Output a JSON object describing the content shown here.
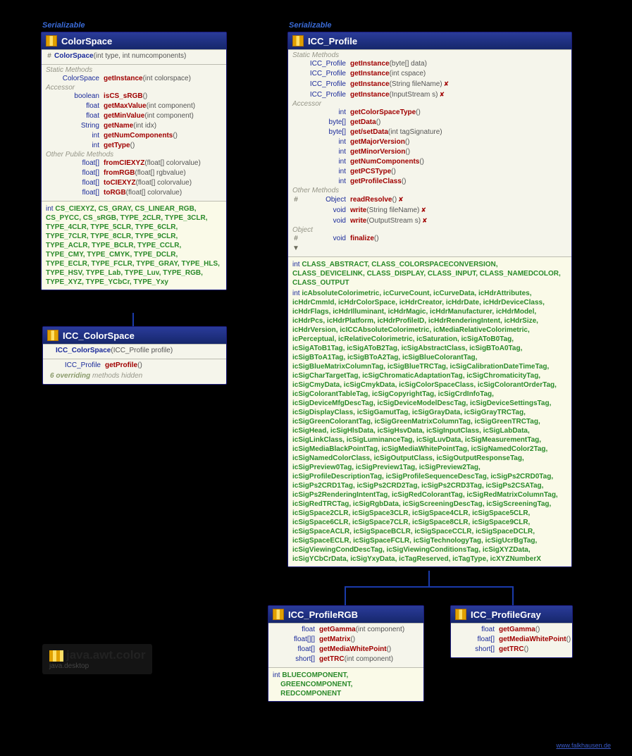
{
  "stereotypes": {
    "colorSpace": "Serializable",
    "iccProfile": "Serializable"
  },
  "colorSpace": {
    "title": "ColorSpace",
    "ctor": {
      "vis": "#",
      "name": "ColorSpace",
      "params": "(int type, int numcomponents)"
    },
    "staticLabel": "Static Methods",
    "staticMethods": [
      {
        "rt": "ColorSpace",
        "name": "getInstance",
        "params": "(int colorspace)"
      }
    ],
    "accessorLabel": "Accessor",
    "accessors": [
      {
        "rt": "boolean",
        "name": "isCS_sRGB",
        "params": "()"
      },
      {
        "rt": "float",
        "name": "getMaxValue",
        "params": "(int component)"
      },
      {
        "rt": "float",
        "name": "getMinValue",
        "params": "(int component)"
      },
      {
        "rt": "String",
        "name": "getName",
        "params": "(int idx)"
      },
      {
        "rt": "int",
        "name": "getNumComponents",
        "params": "()"
      },
      {
        "rt": "int",
        "name": "getType",
        "params": "()"
      }
    ],
    "otherLabel": "Other Public Methods",
    "other": [
      {
        "rt": "float[]",
        "name": "fromCIEXYZ",
        "params": "(float[] colorvalue)"
      },
      {
        "rt": "float[]",
        "name": "fromRGB",
        "params": "(float[] rgbvalue)"
      },
      {
        "rt": "float[]",
        "name": "toCIEXYZ",
        "params": "(float[] colorvalue)"
      },
      {
        "rt": "float[]",
        "name": "toRGB",
        "params": "(float[] colorvalue)"
      }
    ],
    "constants": "int CS_CIEXYZ, CS_GRAY, CS_LINEAR_RGB, CS_PYCC, CS_sRGB, TYPE_2CLR, TYPE_3CLR, TYPE_4CLR, TYPE_5CLR, TYPE_6CLR, TYPE_7CLR, TYPE_8CLR, TYPE_9CLR, TYPE_ACLR, TYPE_BCLR, TYPE_CCLR, TYPE_CMY, TYPE_CMYK, TYPE_DCLR, TYPE_ECLR, TYPE_FCLR, TYPE_GRAY, TYPE_HLS, TYPE_HSV, TYPE_Lab, TYPE_Luv, TYPE_RGB, TYPE_XYZ, TYPE_YCbCr, TYPE_Yxy"
  },
  "iccColorSpace": {
    "title": "ICC_ColorSpace",
    "ctor": {
      "name": "ICC_ColorSpace",
      "params": "(ICC_Profile profile)"
    },
    "method": {
      "rt": "ICC_Profile",
      "name": "getProfile",
      "params": "()"
    },
    "note": "6 overriding methods hidden"
  },
  "iccProfile": {
    "title": "ICC_Profile",
    "staticLabel": "Static Methods",
    "staticMethods": [
      {
        "rt": "ICC_Profile",
        "name": "getInstance",
        "params": "(byte[] data)"
      },
      {
        "rt": "ICC_Profile",
        "name": "getInstance",
        "params": "(int cspace)"
      },
      {
        "rt": "ICC_Profile",
        "name": "getInstance",
        "params": "(String fileName)",
        "throws": "✘"
      },
      {
        "rt": "ICC_Profile",
        "name": "getInstance",
        "params": "(InputStream s)",
        "throws": "✘"
      }
    ],
    "accessorLabel": "Accessor",
    "accessors": [
      {
        "rt": "int",
        "name": "getColorSpaceType",
        "params": "()"
      },
      {
        "rt": "byte[]",
        "name": "getData",
        "params": "()"
      },
      {
        "rt": "byte[]",
        "name": "get/setData",
        "params": "(int tagSignature)"
      },
      {
        "rt": "int",
        "name": "getMajorVersion",
        "params": "()"
      },
      {
        "rt": "int",
        "name": "getMinorVersion",
        "params": "()"
      },
      {
        "rt": "int",
        "name": "getNumComponents",
        "params": "()"
      },
      {
        "rt": "int",
        "name": "getPCSType",
        "params": "()"
      },
      {
        "rt": "int",
        "name": "getProfileClass",
        "params": "()"
      }
    ],
    "otherLabel": "Other Methods",
    "other": [
      {
        "vis": "#",
        "rt": "Object",
        "name": "readResolve",
        "params": "()",
        "throws": "✘"
      },
      {
        "rt": "void",
        "name": "write",
        "params": "(String fileName)",
        "throws": "✘"
      },
      {
        "rt": "void",
        "name": "write",
        "params": "(OutputStream s)",
        "throws": "✘"
      }
    ],
    "objectLabel": "Object",
    "objectMethods": [
      {
        "vis": "# ▼",
        "rt": "void",
        "name": "finalize",
        "params": "()"
      }
    ],
    "constants1": "int CLASS_ABSTRACT, CLASS_COLORSPACECONVERSION, CLASS_DEVICELINK, CLASS_DISPLAY, CLASS_INPUT, CLASS_NAMEDCOLOR, CLASS_OUTPUT",
    "constants2": "int icAbsoluteColorimetric, icCurveCount, icCurveData, icHdrAttributes, icHdrCmmId, icHdrColorSpace, icHdrCreator, icHdrDate, icHdrDeviceClass, icHdrFlags, icHdrIlluminant, icHdrMagic, icHdrManufacturer, icHdrModel, icHdrPcs, icHdrPlatform, icHdrProfileID, icHdrRenderingIntent, icHdrSize, icHdrVersion, icICCAbsoluteColorimetric, icMediaRelativeColorimetric, icPerceptual, icRelativeColorimetric, icSaturation, icSigAToB0Tag, icSigAToB1Tag, icSigAToB2Tag, icSigAbstractClass, icSigBToA0Tag, icSigBToA1Tag, icSigBToA2Tag, icSigBlueColorantTag, icSigBlueMatrixColumnTag, icSigBlueTRCTag, icSigCalibrationDateTimeTag, icSigCharTargetTag, icSigChromaticAdaptationTag, icSigChromaticityTag, icSigCmyData, icSigCmykData, icSigColorSpaceClass, icSigColorantOrderTag, icSigColorantTableTag, icSigCopyrightTag, icSigCrdInfoTag, icSigDeviceMfgDescTag, icSigDeviceModelDescTag, icSigDeviceSettingsTag, icSigDisplayClass, icSigGamutTag, icSigGrayData, icSigGrayTRCTag, icSigGreenColorantTag, icSigGreenMatrixColumnTag, icSigGreenTRCTag, icSigHead, icSigHlsData, icSigHsvData, icSigInputClass, icSigLabData, icSigLinkClass, icSigLuminanceTag, icSigLuvData, icSigMeasurementTag, icSigMediaBlackPointTag, icSigMediaWhitePointTag, icSigNamedColor2Tag, icSigNamedColorClass, icSigOutputClass, icSigOutputResponseTag, icSigPreview0Tag, icSigPreview1Tag, icSigPreview2Tag, icSigProfileDescriptionTag, icSigProfileSequenceDescTag, icSigPs2CRD0Tag, icSigPs2CRD1Tag, icSigPs2CRD2Tag, icSigPs2CRD3Tag, icSigPs2CSATag, icSigPs2RenderingIntentTag, icSigRedColorantTag, icSigRedMatrixColumnTag, icSigRedTRCTag, icSigRgbData, icSigScreeningDescTag, icSigScreeningTag, icSigSpace2CLR, icSigSpace3CLR, icSigSpace4CLR, icSigSpace5CLR, icSigSpace6CLR, icSigSpace7CLR, icSigSpace8CLR, icSigSpace9CLR, icSigSpaceACLR, icSigSpaceBCLR, icSigSpaceCCLR, icSigSpaceDCLR, icSigSpaceECLR, icSigSpaceFCLR, icSigTechnologyTag, icSigUcrBgTag, icSigViewingCondDescTag, icSigViewingConditionsTag, icSigXYZData, icSigYCbCrData, icSigYxyData, icTagReserved, icTagType, icXYZNumberX"
  },
  "iccProfileRGB": {
    "title": "ICC_ProfileRGB",
    "methods": [
      {
        "rt": "float",
        "name": "getGamma",
        "params": "(int component)"
      },
      {
        "rt": "float[][]",
        "name": "getMatrix",
        "params": "()"
      },
      {
        "rt": "float[]",
        "name": "getMediaWhitePoint",
        "params": "()"
      },
      {
        "rt": "short[]",
        "name": "getTRC",
        "params": "(int component)"
      }
    ],
    "constants": "int BLUECOMPONENT, GREENCOMPONENT, REDCOMPONENT"
  },
  "iccProfileGray": {
    "title": "ICC_ProfileGray",
    "methods": [
      {
        "rt": "float",
        "name": "getGamma",
        "params": "()"
      },
      {
        "rt": "float[]",
        "name": "getMediaWhitePoint",
        "params": "()"
      },
      {
        "rt": "short[]",
        "name": "getTRC",
        "params": "()"
      }
    ]
  },
  "package": {
    "name": "java.awt.color",
    "module": "java.desktop"
  },
  "footer": "www.falkhausen.de"
}
